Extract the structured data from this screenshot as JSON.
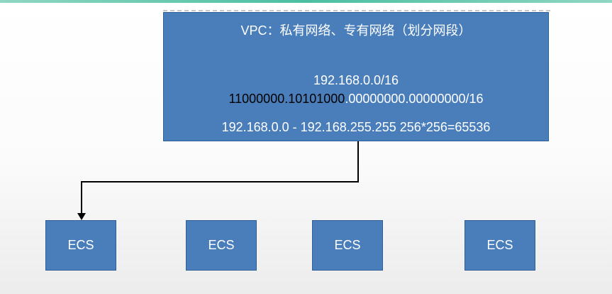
{
  "vpc": {
    "title": "VPC：私有网络、专有网络（划分网段）",
    "cidr": "192.168.0.0/16",
    "binary_prefix": "11000000.10101000",
    "binary_suffix": ".00000000.00000000/16",
    "range": "192.168.0.0 - 192.168.255.255  256*256=65536"
  },
  "ecs_nodes": [
    "ECS",
    "ECS",
    "ECS",
    "ECS"
  ],
  "colors": {
    "box_fill": "#4a7ebb",
    "box_border": "#2f5f96",
    "accent": "#4bbfa0",
    "connector": "#000000"
  }
}
